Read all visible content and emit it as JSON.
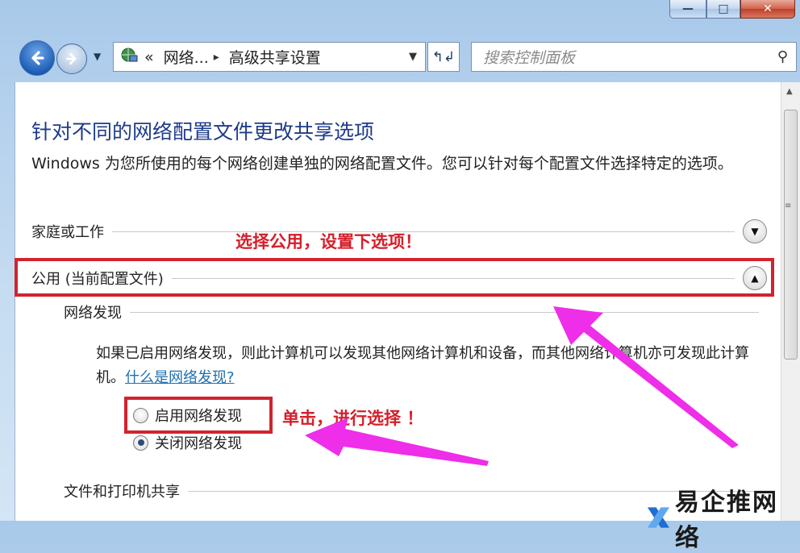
{
  "caption": {
    "minimize": "—",
    "maximize": "□",
    "close": "✕"
  },
  "nav": {
    "address": {
      "prefix": "«",
      "crumb1": "网络...",
      "sep": "▸",
      "crumb2": "高级共享设置"
    },
    "search_placeholder": "搜索控制面板"
  },
  "content": {
    "title": "针对不同的网络配置文件更改共享选项",
    "description": "Windows 为您所使用的每个网络创建单独的网络配置文件。您可以针对每个配置文件选择特定的选项。",
    "sections": {
      "home": "家庭或工作",
      "public": "公用 (当前配置文件)",
      "network_discovery": "网络发现",
      "file_printer": "文件和打印机共享"
    },
    "nd_text": "如果已启用网络发现，则此计算机可以发现其他网络计算机和设备，而其他网络计算机亦可发现此计算机。",
    "nd_link": "什么是网络发现?",
    "radios": [
      {
        "label": "启用网络发现",
        "checked": false
      },
      {
        "label": "关闭网络发现",
        "checked": true
      }
    ]
  },
  "annotations": {
    "note1": "选择公用，设置下选项！",
    "note2": "单击，进行选择 ！",
    "highlight_color": "#d0242e",
    "arrow_color": "#ee2ee8"
  },
  "watermark": "易企推网络",
  "colors": {
    "title": "#1e3b8a",
    "link": "#1e6fb0",
    "frame": "#c5dcf1"
  },
  "icons": [
    "back-arrow-icon",
    "forward-arrow-icon",
    "network-icon",
    "dropdown-arrow-icon",
    "refresh-icon",
    "search-icon",
    "chevron-down-icon",
    "chevron-up-icon",
    "scroll-up-icon",
    "scroll-grip-icon"
  ]
}
